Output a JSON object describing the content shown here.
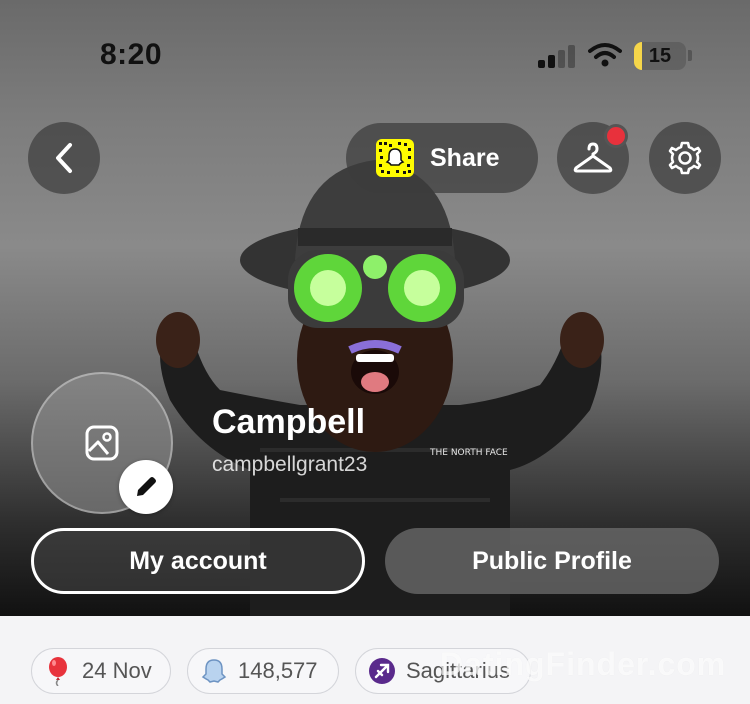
{
  "status_bar": {
    "time": "8:20",
    "battery": "15"
  },
  "header": {
    "share_label": "Share",
    "icons": {
      "back": "chevron-left-icon",
      "hanger": "hanger-icon",
      "settings": "gear-icon",
      "snapcode": "snapcode-icon"
    }
  },
  "profile": {
    "display_name": "Campbell",
    "username": "campbellgrant23",
    "avatar_shirt_text": "THE NORTH FACE"
  },
  "actions": {
    "my_account": "My account",
    "public_profile": "Public Profile"
  },
  "chips": [
    {
      "icon": "balloon-icon",
      "label": "24 Nov"
    },
    {
      "icon": "ghost-icon",
      "label": "148,577"
    },
    {
      "icon": "sagittarius-icon",
      "label": "Sagittarius"
    }
  ],
  "watermark": "DatingFinder.com",
  "colors": {
    "notification": "#e8313c",
    "snapchat_yellow": "#fffc00",
    "zodiac_purple": "#5a2a8c"
  }
}
